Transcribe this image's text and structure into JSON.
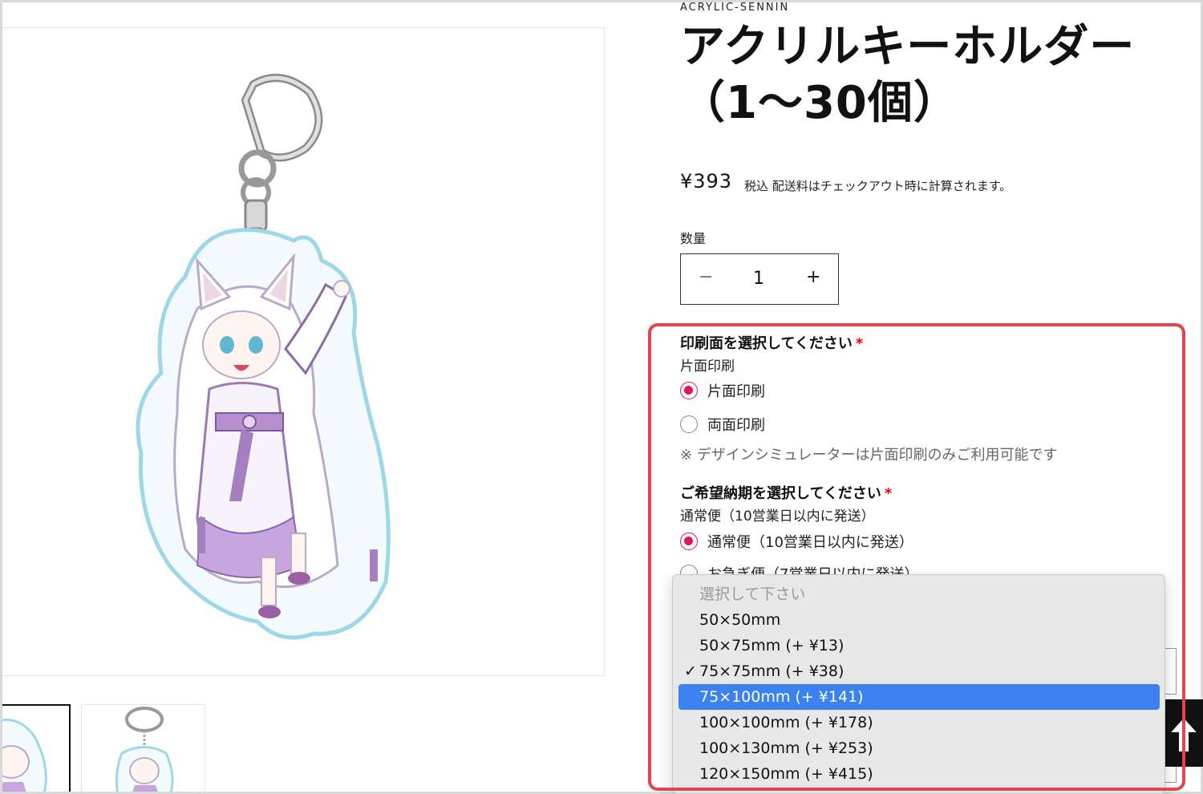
{
  "product": {
    "vendor": "ACRYLIC-SENNIN",
    "title_line1": "アクリルキーホルダー",
    "title_line2": "（1〜30個）",
    "price": "¥393",
    "price_note": "税込 配送料はチェックアウト時に計算されます。"
  },
  "quantity": {
    "label": "数量",
    "minus": "−",
    "value": "1",
    "plus": "+"
  },
  "print_side": {
    "label": "印刷面を選択してください",
    "required_mark": "*",
    "current": "片面印刷",
    "options": [
      "片面印刷",
      "両面印刷"
    ],
    "selected_index": 0,
    "note": "※ デザインシミュレーターは片面印刷のみご利用可能です"
  },
  "delivery": {
    "label": "ご希望納期を選択してください",
    "required_mark": "*",
    "current": "通常便（10営業日以内に発送）",
    "options": [
      "通常便（10営業日以内に発送）",
      "お急ぎ便（7営業日以内に発送）"
    ],
    "selected_index": 0
  },
  "size_dropdown": {
    "placeholder": "選択して下さい",
    "items": [
      "50×50mm",
      "50×75mm (+ ¥13)",
      "75×75mm (+ ¥38)",
      "75×100mm (+ ¥141)",
      "100×100mm (+ ¥178)",
      "100×130mm (+ ¥253)",
      "120×150mm (+ ¥415)"
    ],
    "checkmark": "✓",
    "checked_index": 2,
    "highlighted_index": 3
  },
  "colors": {
    "accent": "#e5155a",
    "highlight_border": "#e8434a",
    "dropdown_selection": "#3b82f0"
  }
}
